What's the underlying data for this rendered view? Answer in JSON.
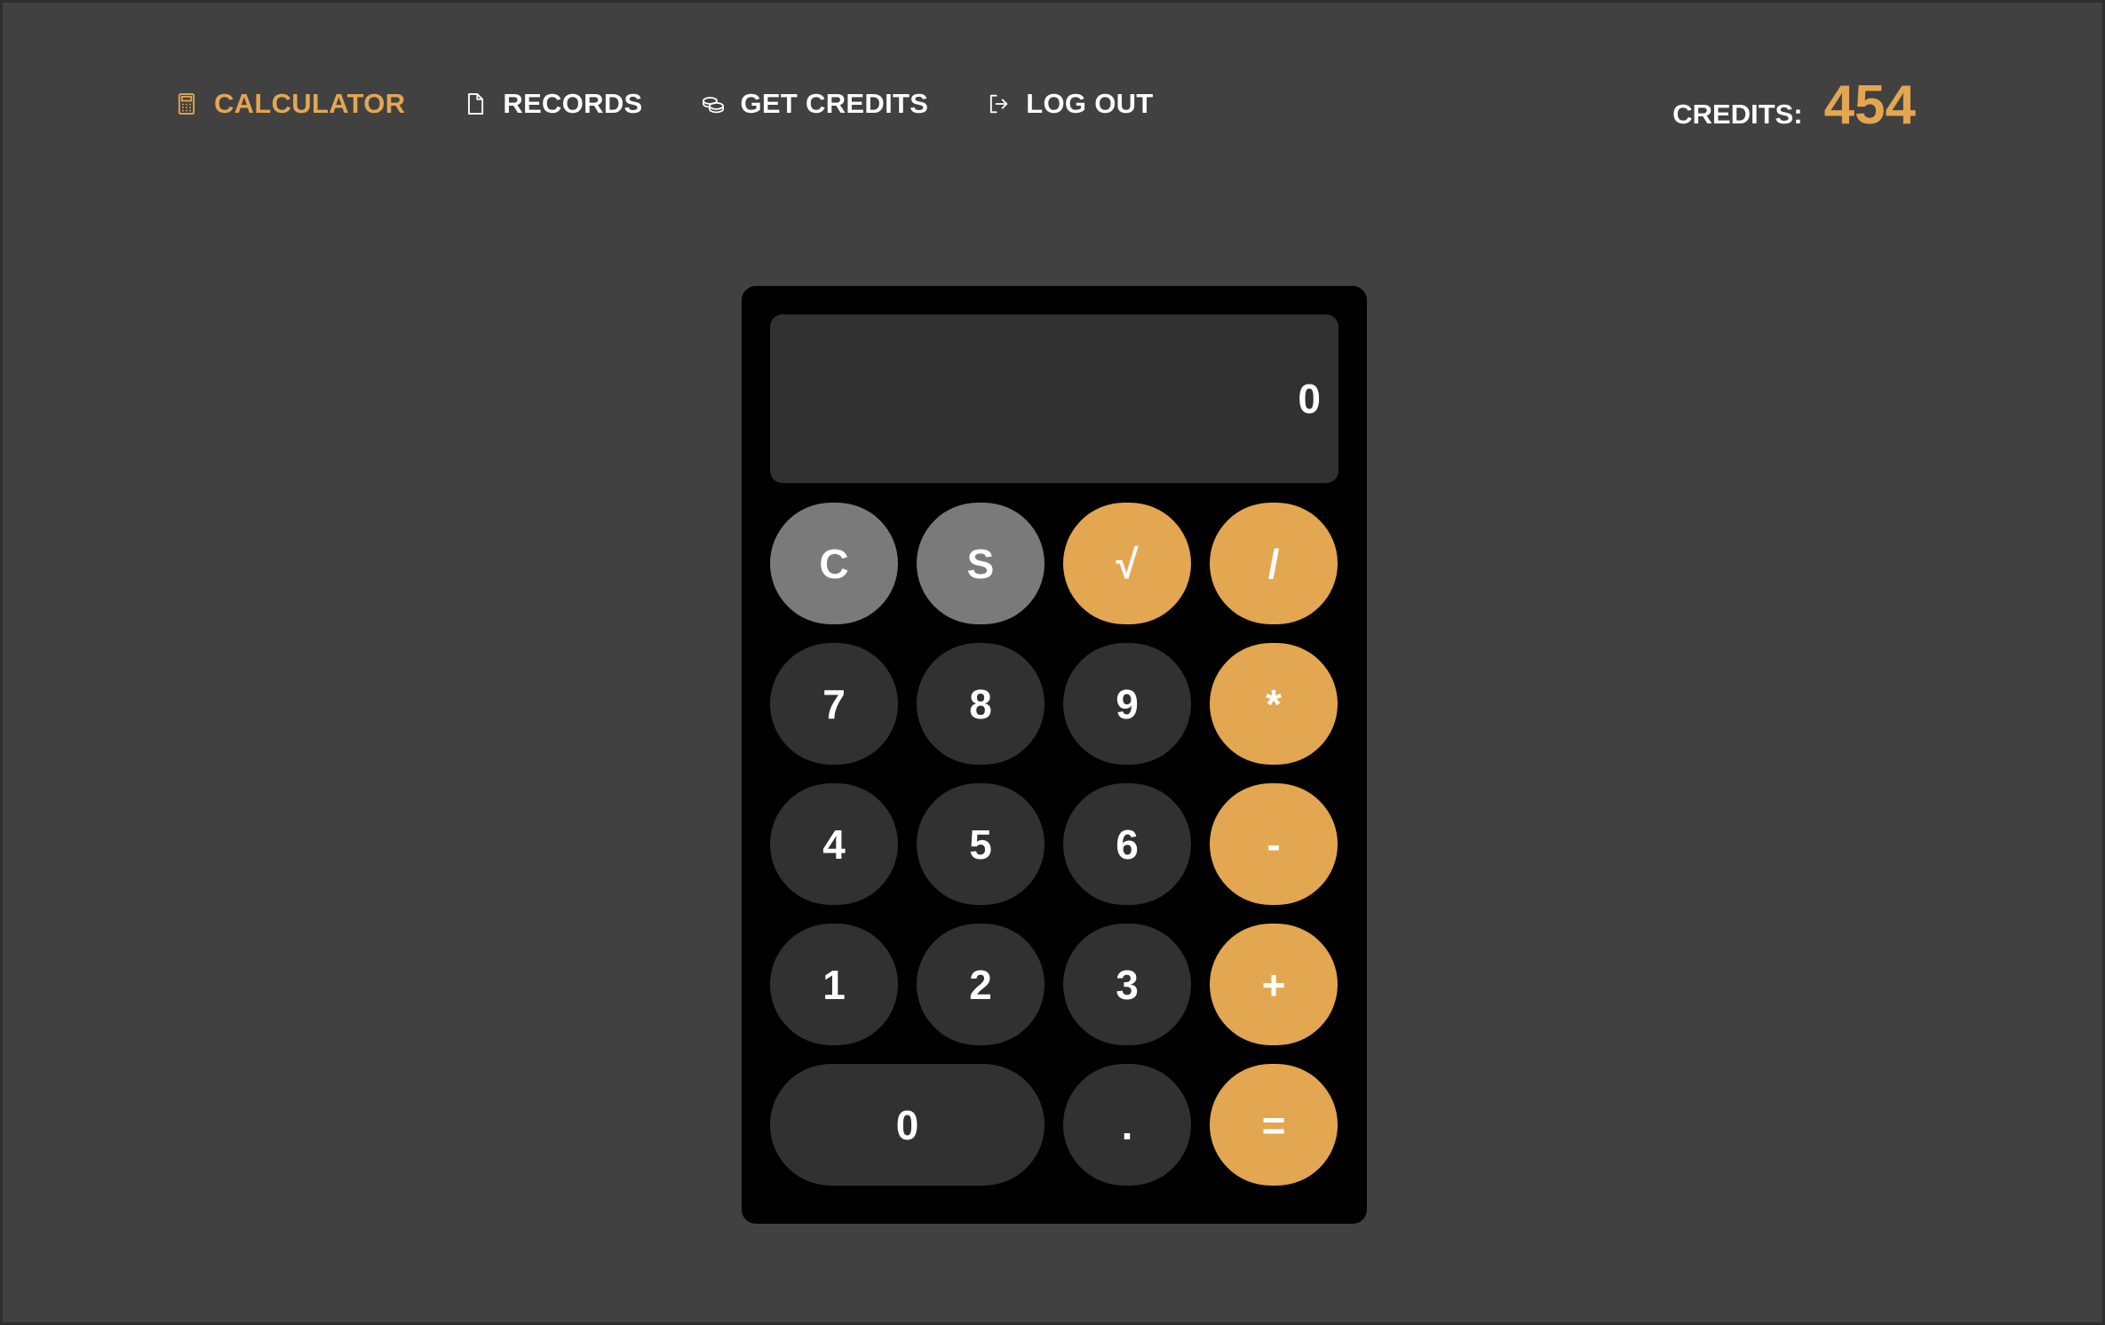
{
  "nav": {
    "items": [
      {
        "label": "CALCULATOR",
        "icon": "calculator-icon",
        "active": true
      },
      {
        "label": "RECORDS",
        "icon": "document-icon",
        "active": false
      },
      {
        "label": "GET CREDITS",
        "icon": "coins-icon",
        "active": false
      },
      {
        "label": "LOG OUT",
        "icon": "logout-icon",
        "active": false
      }
    ]
  },
  "credits": {
    "label": "CREDITS:",
    "value": "454"
  },
  "calculator": {
    "display": "0",
    "keys": [
      {
        "label": "C",
        "kind": "fn"
      },
      {
        "label": "S",
        "kind": "fn"
      },
      {
        "label": "√",
        "kind": "op"
      },
      {
        "label": "/",
        "kind": "op"
      },
      {
        "label": "7",
        "kind": "num"
      },
      {
        "label": "8",
        "kind": "num"
      },
      {
        "label": "9",
        "kind": "num"
      },
      {
        "label": "*",
        "kind": "op"
      },
      {
        "label": "4",
        "kind": "num"
      },
      {
        "label": "5",
        "kind": "num"
      },
      {
        "label": "6",
        "kind": "num"
      },
      {
        "label": "-",
        "kind": "op"
      },
      {
        "label": "1",
        "kind": "num"
      },
      {
        "label": "2",
        "kind": "num"
      },
      {
        "label": "3",
        "kind": "num"
      },
      {
        "label": "+",
        "kind": "op"
      },
      {
        "label": "0",
        "kind": "num"
      },
      {
        "label": ".",
        "kind": "num"
      },
      {
        "label": "=",
        "kind": "op"
      }
    ]
  },
  "colors": {
    "background": "#414141",
    "accent": "#e3a651",
    "calculator_body": "#000000",
    "display_bg": "#313131",
    "function_key": "#7a7a7a",
    "number_key": "#313131",
    "text": "#ffffff"
  }
}
